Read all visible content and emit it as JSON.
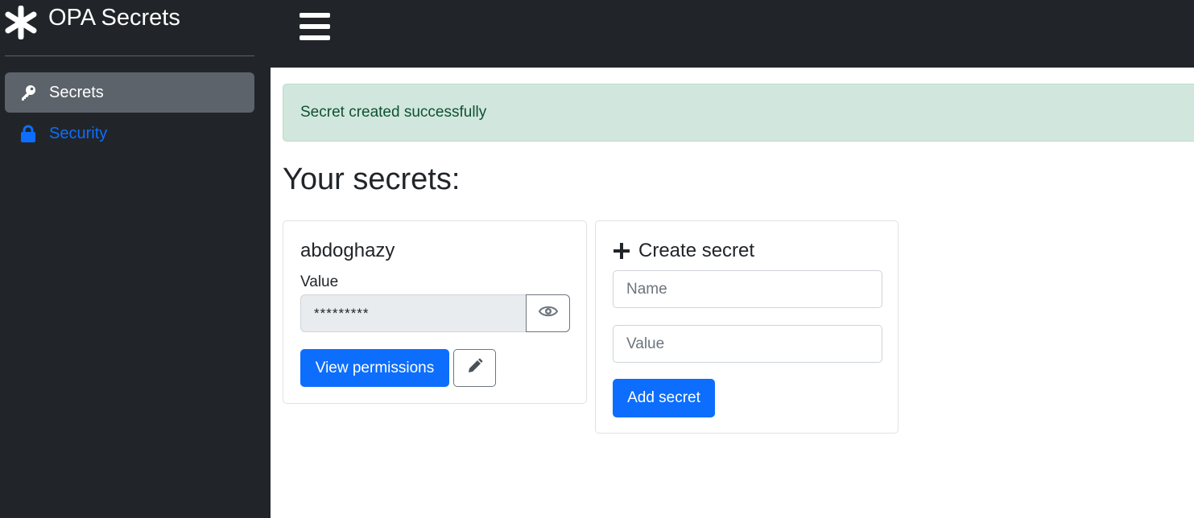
{
  "sidebar": {
    "brand_title": "OPA Secrets",
    "items": [
      {
        "label": "Secrets",
        "icon": "key-icon",
        "active": true
      },
      {
        "label": "Security",
        "icon": "lock-icon",
        "active": false
      }
    ]
  },
  "topbar": {
    "menu_icon": "hamburger-icon"
  },
  "alert": {
    "text": "Secret created successfully"
  },
  "main": {
    "title": "Your secrets:",
    "secrets": [
      {
        "name": "abdoghazy",
        "value_label": "Value",
        "masked_value": "*********",
        "view_permissions_label": "View permissions"
      }
    ],
    "create": {
      "heading": "Create secret",
      "name_placeholder": "Name",
      "value_placeholder": "Value",
      "submit_label": "Add secret"
    }
  },
  "colors": {
    "sidebar_bg": "#212529",
    "active_item_bg": "#5c636a",
    "link": "#0d6efd",
    "primary": "#0d6efd",
    "alert_bg": "#d1e7dd",
    "alert_text": "#0f5132"
  }
}
